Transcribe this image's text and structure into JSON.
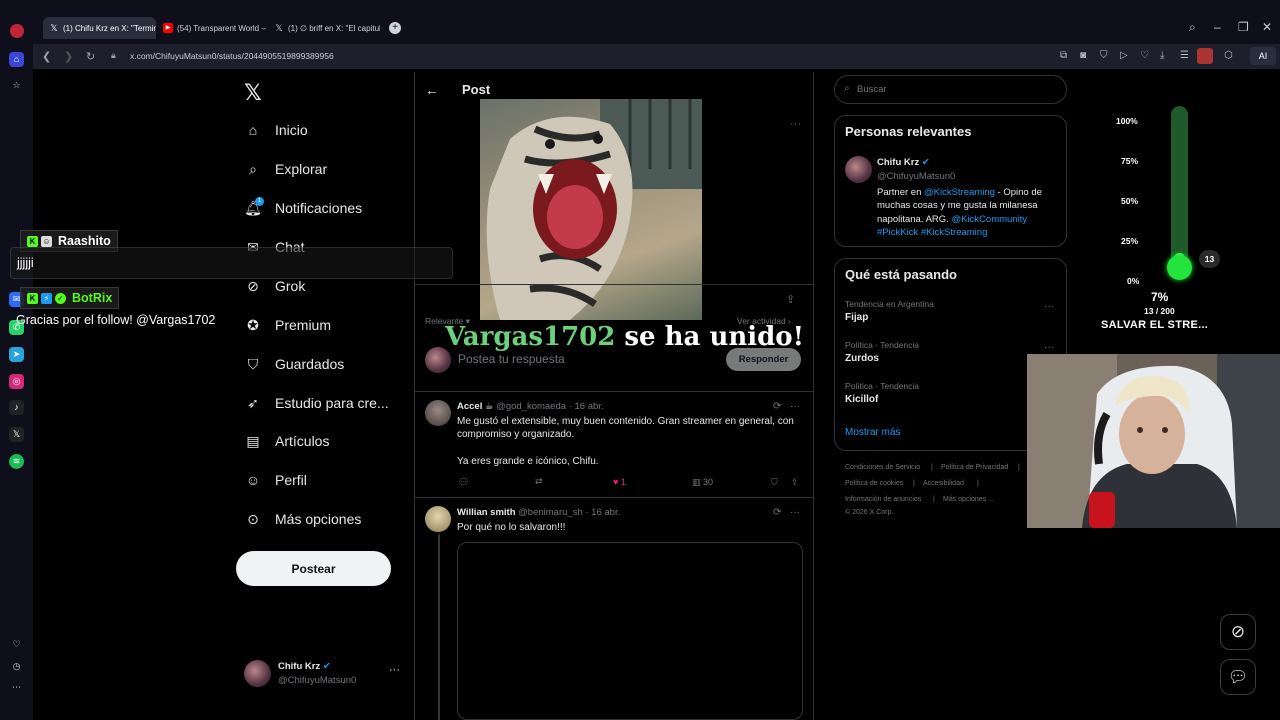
{
  "browser": {
    "tabs": [
      {
        "label": "(1) Chifu Krz en X: \"Termin",
        "icon": "x-logo",
        "active": true
      },
      {
        "label": "(54) Transparent World – /",
        "icon": "youtube-icon",
        "active": false
      },
      {
        "label": "(1) ∅ briff en X: \"El capitul",
        "icon": "x-logo",
        "active": false
      }
    ],
    "url": "x.com/ChifuyuMatsun0/status/2044905519899389956",
    "ai_label": "AI"
  },
  "nav": {
    "items": [
      {
        "label": "Inicio",
        "icon": "home-icon"
      },
      {
        "label": "Explorar",
        "icon": "search-icon"
      },
      {
        "label": "Notificaciones",
        "icon": "bell-icon"
      },
      {
        "label": "Chat",
        "icon": "chat-icon"
      },
      {
        "label": "Grok",
        "icon": "grok-icon"
      },
      {
        "label": "Premium",
        "icon": "premium-icon"
      },
      {
        "label": "Guardados",
        "icon": "bookmark-icon"
      },
      {
        "label": "Estudio para cre...",
        "icon": "rocket-icon"
      },
      {
        "label": "Artículos",
        "icon": "article-icon"
      },
      {
        "label": "Perfil",
        "icon": "person-icon"
      },
      {
        "label": "Más opciones",
        "icon": "more-circle-icon"
      }
    ],
    "notif_count": "1",
    "post_button": "Postear",
    "account": {
      "name": "Chifu Krz",
      "handle": "@ChifuyuMatsun0"
    }
  },
  "main": {
    "title": "Post",
    "sort_left": "Relevante",
    "sort_right": "Ver actividad",
    "reply_placeholder": "Postea tu respuesta",
    "reply_button": "Responder",
    "replies": [
      {
        "name": "Accel",
        "handle": "@god_komaeda",
        "date": "16 abr.",
        "text1": "Me gustó el extensible, muy buen contenido. Gran streamer en general, con compromiso y organizado.",
        "text2": "Ya eres grande e icónico, Chifu.",
        "likes": "1",
        "views": "30"
      },
      {
        "name": "Willian smith",
        "handle": "@benimaru_sh",
        "date": "16 abr.",
        "text1": "Por qué no lo salvaron!!!"
      }
    ]
  },
  "right": {
    "search_placeholder": "Buscar",
    "relevant": {
      "title": "Personas relevantes",
      "name": "Chifu Krz",
      "handle": "@ChifuyuMatsun0",
      "bio_parts": [
        "Partner en ",
        "@KickStreaming",
        " - Opino de muchas cosas y me gusta la milanesa napolitana. ARG. ",
        "@KickCommunity",
        " ",
        "#PickKick",
        " ",
        "#KickStreaming"
      ]
    },
    "trends": {
      "title": "Qué está pasando",
      "items": [
        {
          "context": "Tendencia en Argentina",
          "name": "Fijap"
        },
        {
          "context": "Política · Tendencia",
          "name": "Zurdos"
        },
        {
          "context": "Política · Tendencia",
          "name": "Kicillof"
        }
      ],
      "more": "Mostrar más"
    },
    "footer": [
      "Condiciones de Servicio",
      "|",
      "Política de Privacidad",
      "|",
      "Política de cookies",
      "|",
      "Accesibilidad",
      "|",
      "Información de anuncios",
      "|",
      "Más opciones ...",
      "© 2026 X Corp."
    ]
  },
  "overlay": {
    "chat": [
      {
        "user": "Raashito",
        "message": "jjjjji"
      },
      {
        "user": "BotRix",
        "message": "Gracias por el follow! @Vargas1702"
      }
    ],
    "joined_user": "Vargas1702",
    "joined_text": " se ha unido!",
    "goal": {
      "ticks": [
        "100%",
        "75%",
        "50%",
        "25%",
        "0%"
      ],
      "count": "13",
      "percent": "7%",
      "fraction": "13 / 200",
      "level": 0.065,
      "title": "SALVAR EL STRE..."
    }
  },
  "colors": {
    "accent": "#1d9bf0",
    "like": "#f91880",
    "goal": "#22e43d",
    "chat_user": "#6cd17a"
  }
}
